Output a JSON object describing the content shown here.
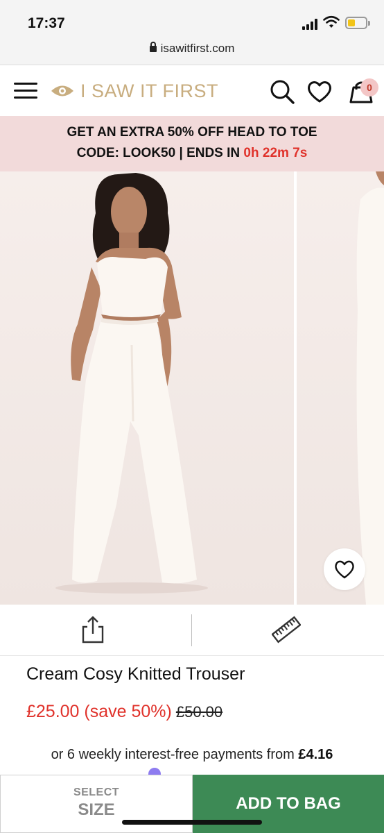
{
  "status_bar": {
    "time": "17:37"
  },
  "browser": {
    "url": "isawitfirst.com"
  },
  "header": {
    "brand": "I SAW IT FIRST",
    "bag_count": "0"
  },
  "promo": {
    "line1": "GET AN EXTRA 50% OFF HEAD TO TOE",
    "line2_prefix": "CODE: LOOK50 | ENDS IN ",
    "countdown": "0h 22m 7s"
  },
  "product": {
    "name": "Cream Cosy Knitted Trouser",
    "price": "£25.00 (save 50%)",
    "was_price": "£50.00",
    "installments_prefix": "or 6 weekly interest-free payments from ",
    "installment_amount": "£4.16"
  },
  "bottom_bar": {
    "select_label_top": "SELECT",
    "select_label_bottom": "SIZE",
    "add_to_bag": "ADD TO BAG"
  },
  "colors": {
    "brand_gold": "#c8ad7f",
    "promo_bg": "#f2dada",
    "sale_red": "#e0322b",
    "add_button": "#3d8a55"
  },
  "icons": [
    "menu-icon",
    "eye-logo-icon",
    "search-icon",
    "heart-icon",
    "bag-icon",
    "share-icon",
    "ruler-icon",
    "lock-icon"
  ]
}
